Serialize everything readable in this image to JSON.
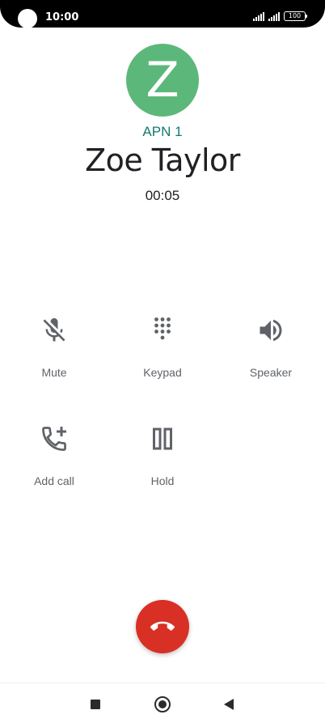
{
  "status_bar": {
    "time": "10:00",
    "battery": "100"
  },
  "contact": {
    "avatar_letter": "Z",
    "account": "APN 1",
    "name": "Zoe Taylor",
    "duration": "00:05"
  },
  "controls": {
    "mute": "Mute",
    "keypad": "Keypad",
    "speaker": "Speaker",
    "add_call": "Add call",
    "hold": "Hold"
  },
  "colors": {
    "avatar": "#5cb87a",
    "account": "#137a6c",
    "end_call": "#d93025"
  },
  "icons": {
    "mute": "mic-off-icon",
    "keypad": "dialpad-icon",
    "speaker": "volume-up-icon",
    "add_call": "add-call-icon",
    "hold": "pause-icon",
    "end_call": "call-end-icon"
  }
}
